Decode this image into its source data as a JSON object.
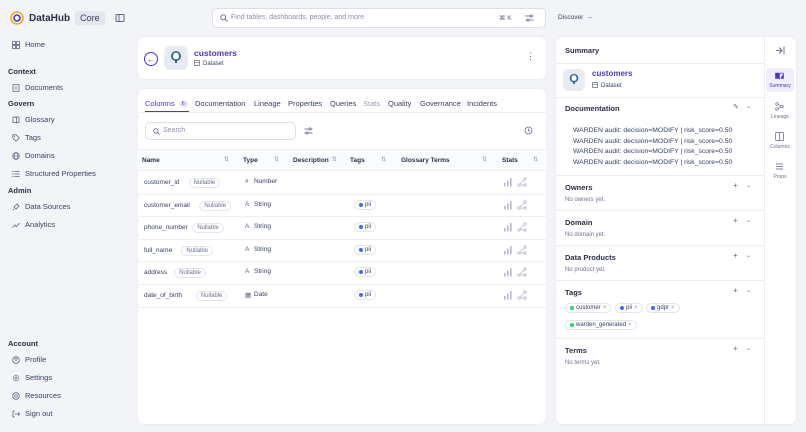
{
  "app": {
    "name": "DataHub",
    "edition": "Core"
  },
  "search": {
    "placeholder": "Find tables, dashboards, people, and more",
    "shortcut": "⌘ K"
  },
  "discover_label": "Discover",
  "sidebar": {
    "home": "Home",
    "context_header": "Context",
    "documents": "Documents",
    "govern_header": "Govern",
    "glossary": "Glossary",
    "tags": "Tags",
    "domains": "Domains",
    "structured_properties": "Structured Properties",
    "admin_header": "Admin",
    "data_sources": "Data Sources",
    "analytics": "Analytics",
    "account_header": "Account",
    "profile": "Profile",
    "settings": "Settings",
    "resources": "Resources",
    "sign_out": "Sign out"
  },
  "entity": {
    "name": "customers",
    "type": "Dataset"
  },
  "tabs": {
    "columns": "Columns",
    "columns_count": "6",
    "documentation": "Documentation",
    "lineage": "Lineage",
    "properties": "Properties",
    "queries": "Queries",
    "stats": "Stats",
    "quality": "Quality",
    "governance": "Governance",
    "incidents": "Incidents"
  },
  "table_search_placeholder": "Search",
  "table": {
    "headers": {
      "name": "Name",
      "type": "Type",
      "description": "Description",
      "tags": "Tags",
      "glossary": "Glossary Terms",
      "stats": "Stats"
    },
    "rows": [
      {
        "name": "customer_id",
        "nullable": "Nullable",
        "type": "Number",
        "tag": ""
      },
      {
        "name": "customer_email",
        "nullable": "Nullable",
        "type": "String",
        "tag": "pii"
      },
      {
        "name": "phone_number",
        "nullable": "Nullable",
        "type": "String",
        "tag": "pii"
      },
      {
        "name": "full_name",
        "nullable": "Nullable",
        "type": "String",
        "tag": "pii"
      },
      {
        "name": "address",
        "nullable": "Nullable",
        "type": "String",
        "tag": "pii"
      },
      {
        "name": "date_of_birth",
        "nullable": "Nullable",
        "type": "Date",
        "tag": "pii"
      }
    ]
  },
  "summary": {
    "title": "Summary",
    "documentation_title": "Documentation",
    "doc_lines": [
      "WARDEN audit: decision=MODIFY | risk_score=0.50",
      "WARDEN audit: decision=MODIFY | risk_score=0.50",
      "WARDEN audit: decision=MODIFY | risk_score=0.50",
      "WARDEN audit: decision=MODIFY | risk_score=0.50"
    ],
    "owners_title": "Owners",
    "owners_empty": "No owners yet.",
    "domain_title": "Domain",
    "domain_empty": "No domain yet.",
    "products_title": "Data Products",
    "products_empty": "No product yet.",
    "tags_title": "Tags",
    "tags": [
      "customer",
      "pii",
      "gdpr",
      "warden_generated"
    ],
    "terms_title": "Terms",
    "terms_empty": "No terms yet."
  },
  "rail": {
    "summary": "Summary",
    "lineage": "Lineage",
    "columns": "Columns",
    "props": "Props"
  },
  "colors": {
    "accent": "#4b39bc",
    "tag_green": "#34c97b",
    "tag_blue": "#3b6df0"
  }
}
